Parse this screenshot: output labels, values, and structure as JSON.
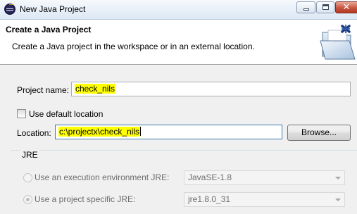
{
  "window": {
    "title": "New Java Project",
    "close_glyph": "✕"
  },
  "banner": {
    "title": "Create a Java Project",
    "description": "Create a Java project in the workspace or in an external location.",
    "icon": "new-java-project-folder-icon"
  },
  "form": {
    "project_name_label": "Project name:",
    "project_name_value": "check_nils",
    "use_default_location_label": "Use default location",
    "use_default_location_checked": false,
    "location_label": "Location:",
    "location_value": "c:\\projectx\\check_nils",
    "browse_label": "Browse..."
  },
  "jre": {
    "group_label": "JRE",
    "exec_env_label": "Use an execution environment JRE:",
    "exec_env_value": "JavaSE-1.8",
    "specific_label": "Use a project specific JRE:",
    "specific_value": "jre1.8.0_31",
    "selected_option": "specific"
  },
  "colors": {
    "highlight": "#ffff00",
    "banner_bg": "#ffffff",
    "dialog_bg": "#f0f0f0"
  }
}
